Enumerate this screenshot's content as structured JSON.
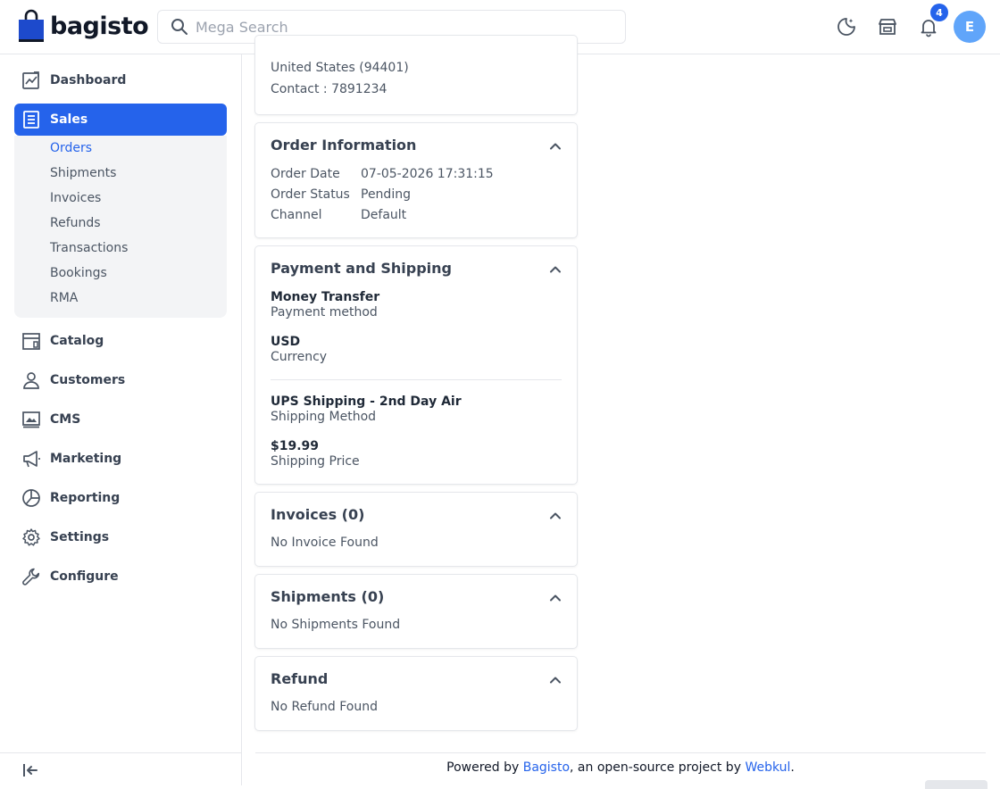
{
  "header": {
    "brand": "bagisto",
    "search": {
      "placeholder": "Mega Search",
      "value": ""
    },
    "notification_count": "4",
    "avatar_initial": "E"
  },
  "sidebar": {
    "items": [
      {
        "label": "Dashboard",
        "icon": "dashboard-icon"
      },
      {
        "label": "Sales",
        "icon": "sales-icon",
        "active": true
      },
      {
        "label": "Catalog",
        "icon": "catalog-icon"
      },
      {
        "label": "Customers",
        "icon": "customers-icon"
      },
      {
        "label": "CMS",
        "icon": "cms-icon"
      },
      {
        "label": "Marketing",
        "icon": "marketing-icon"
      },
      {
        "label": "Reporting",
        "icon": "reporting-icon"
      },
      {
        "label": "Settings",
        "icon": "settings-icon"
      },
      {
        "label": "Configure",
        "icon": "configure-icon"
      }
    ],
    "sales_sub": [
      "Orders",
      "Shipments",
      "Invoices",
      "Refunds",
      "Transactions",
      "Bookings",
      "RMA"
    ]
  },
  "address_card": {
    "country_line": "United States (94401)",
    "contact_line": "Contact : 7891234"
  },
  "order_info": {
    "title": "Order Information",
    "rows": [
      {
        "label": "Order Date",
        "value": "07-05-2026 17:31:15"
      },
      {
        "label": "Order Status",
        "value": "Pending"
      },
      {
        "label": "Channel",
        "value": "Default"
      }
    ]
  },
  "payment_shipping": {
    "title": "Payment and Shipping",
    "payment_method": "Money Transfer",
    "payment_method_label": "Payment method",
    "currency": "USD",
    "currency_label": "Currency",
    "shipping_method": "UPS Shipping - 2nd Day Air",
    "shipping_method_label": "Shipping Method",
    "shipping_price": "$19.99",
    "shipping_price_label": "Shipping Price"
  },
  "invoices": {
    "title": "Invoices (0)",
    "empty": "No Invoice Found"
  },
  "shipments": {
    "title": "Shipments (0)",
    "empty": "No Shipments Found"
  },
  "refund": {
    "title": "Refund",
    "empty": "No Refund Found"
  },
  "footer": {
    "prefix": "Powered by ",
    "link1": "Bagisto",
    "middle": ", an open-source project by ",
    "link2": "Webkul",
    "suffix": "."
  },
  "colors": {
    "accent": "#2563eb",
    "avatar": "#60a5fa"
  }
}
